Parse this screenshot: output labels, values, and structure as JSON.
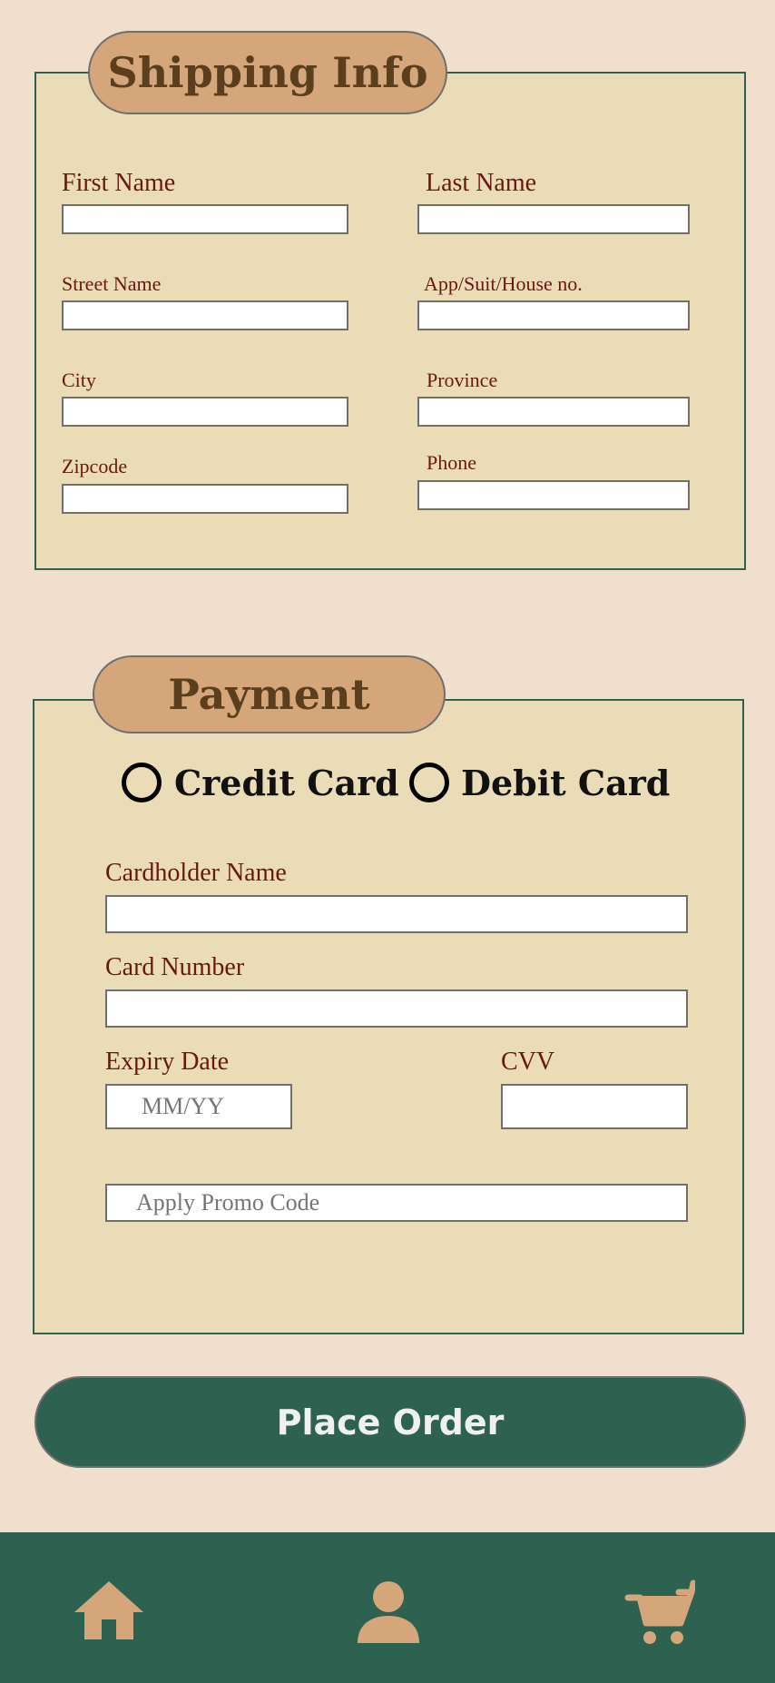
{
  "colors": {
    "page_bg": "#f0dfcd",
    "panel_bg": "#eadcb7",
    "pill_bg": "#d5a679",
    "accent_green": "#2d6150",
    "label_color": "#6a1710",
    "icon_color": "#d5a679"
  },
  "shipping": {
    "title": "Shipping Info",
    "first_name_label": "First Name",
    "last_name_label": "Last Name",
    "street_label": "Street Name",
    "apt_label": "App/Suit/House no.",
    "city_label": "City",
    "province_label": "Province",
    "zipcode_label": "Zipcode",
    "phone_label": "Phone"
  },
  "payment": {
    "title": "Payment",
    "options": [
      "Credit Card",
      "Debit Card"
    ],
    "cardholder_label": "Cardholder Name",
    "card_number_label": "Card Number",
    "expiry_label": "Expiry Date",
    "expiry_placeholder": "MM/YY",
    "cvv_label": "CVV",
    "promo_placeholder": "Apply Promo Code"
  },
  "place_order_label": "Place Order",
  "nav": {
    "icons": [
      "home-icon",
      "profile-icon",
      "cart-icon"
    ]
  }
}
